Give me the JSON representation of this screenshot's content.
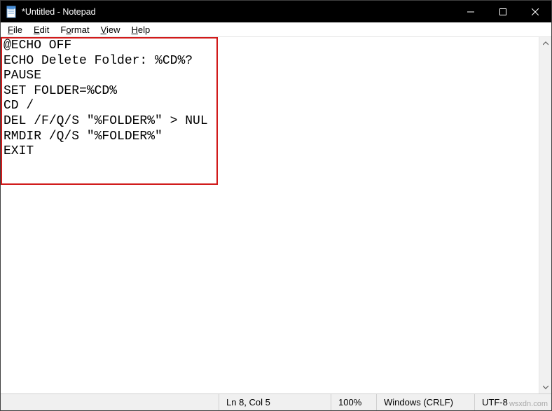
{
  "window_title": "*Untitled - Notepad",
  "menu": {
    "file": "File",
    "edit": "Edit",
    "format": "Format",
    "view": "View",
    "help": "Help"
  },
  "editor_content": "@ECHO OFF\nECHO Delete Folder: %CD%?\nPAUSE\nSET FOLDER=%CD%\nCD /\nDEL /F/Q/S \"%FOLDER%\" > NUL\nRMDIR /Q/S \"%FOLDER%\"\nEXIT",
  "statusbar": {
    "position": "Ln 8, Col 5",
    "zoom": "100%",
    "line_ending": "Windows (CRLF)",
    "encoding": "UTF-8"
  },
  "watermark": "wsxdn.com"
}
